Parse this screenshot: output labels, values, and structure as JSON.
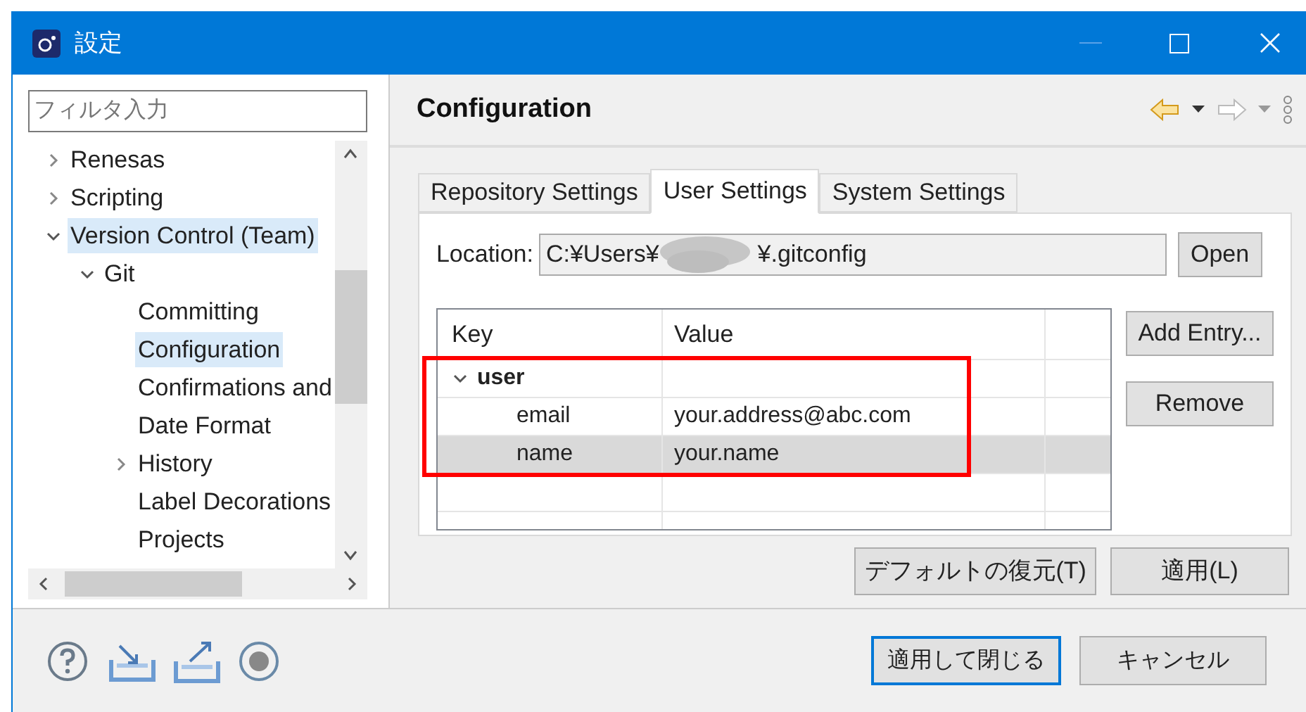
{
  "window": {
    "title": "設定"
  },
  "filter": {
    "placeholder": "フィルタ入力"
  },
  "tree": [
    {
      "label": "Renesas",
      "expanded": false,
      "selected": false
    },
    {
      "label": "Scripting",
      "expanded": false,
      "selected": false
    },
    {
      "label": "Version Control (Team)",
      "expanded": true,
      "selected": true,
      "children": [
        {
          "label": "Git",
          "expanded": true,
          "selected": false,
          "children": [
            {
              "label": "Committing",
              "selected": false
            },
            {
              "label": "Configuration",
              "selected": true
            },
            {
              "label": "Confirmations and",
              "selected": false
            },
            {
              "label": "Date Format",
              "selected": false
            },
            {
              "label": "History",
              "expanded": false,
              "selected": false
            },
            {
              "label": "Label Decorations",
              "selected": false
            },
            {
              "label": "Projects",
              "selected": false
            }
          ]
        }
      ]
    }
  ],
  "page": {
    "title": "Configuration"
  },
  "tabs": [
    {
      "label": "Repository Settings",
      "selected": false
    },
    {
      "label": "User Settings",
      "selected": true
    },
    {
      "label": "System Settings",
      "selected": false
    }
  ],
  "location": {
    "label": "Location:",
    "value_start": "C:¥Users¥",
    "value_end": "¥.gitconfig",
    "open_button": "Open"
  },
  "table": {
    "columns": [
      "Key",
      "Value"
    ],
    "rows": [
      {
        "key": "user",
        "expanded": true,
        "selected": false,
        "children": [
          {
            "key": "email",
            "value": "your.address@abc.com",
            "selected": false
          },
          {
            "key": "name",
            "value": "your.name",
            "selected": true
          }
        ]
      }
    ]
  },
  "side_buttons": [
    "Add Entry...",
    "Remove"
  ],
  "page_buttons": [
    "デフォルトの復元(T)",
    "適用(L)"
  ],
  "dialog_buttons": [
    {
      "label": "適用して閉じる",
      "default": true
    },
    {
      "label": "キャンセル",
      "default": false
    }
  ]
}
